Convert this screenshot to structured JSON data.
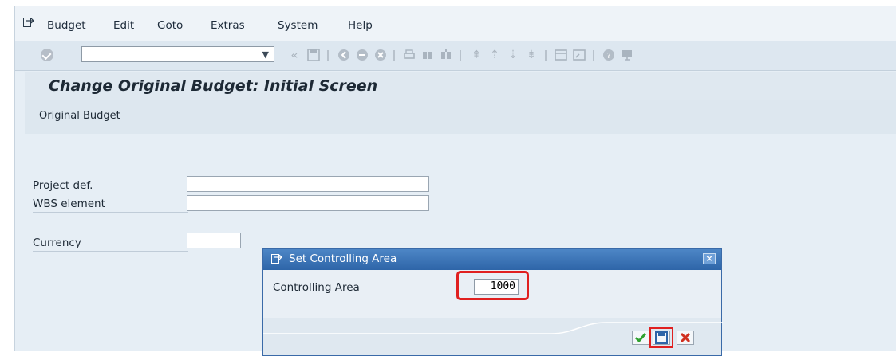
{
  "menu": [
    "Budget",
    "Edit",
    "Goto",
    "Extras",
    "System",
    "Help"
  ],
  "toolbar": {
    "command_value": ""
  },
  "title": "Change Original Budget: Initial Screen",
  "appbar": {
    "button": "Original Budget"
  },
  "fields": {
    "project_def": {
      "label": "Project def.",
      "value": ""
    },
    "wbs_element": {
      "label": "WBS element",
      "value": ""
    },
    "currency": {
      "label": "Currency",
      "value": ""
    }
  },
  "dialog": {
    "title": "Set Controlling Area",
    "label": "Controlling Area",
    "value": "1000",
    "close": "×"
  },
  "colors": {
    "dialog_title": "#2e65a8",
    "highlight": "#e02020",
    "confirm": "#2fa12f",
    "cancel": "#d03020"
  },
  "icons": {
    "menu": "menu-icon",
    "enter": "check-circle-icon",
    "save": "save-icon",
    "confirm": "checkmark-icon",
    "cancel": "cancel-icon"
  }
}
